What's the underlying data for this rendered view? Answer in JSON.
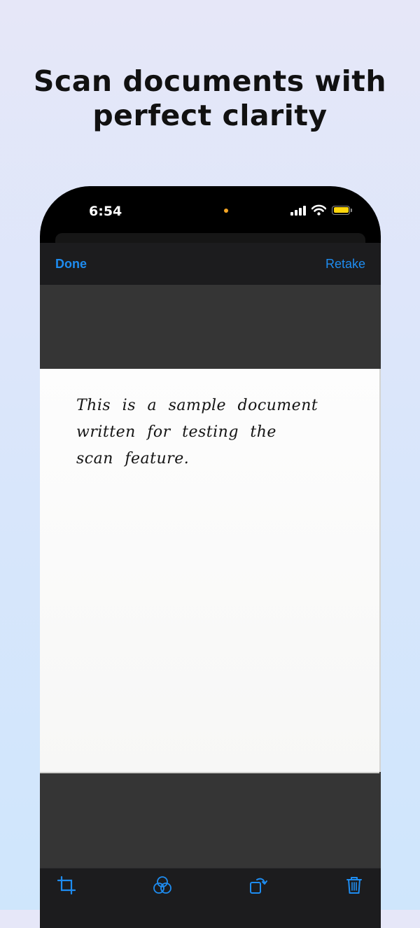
{
  "headline": {
    "line1": "Scan documents with",
    "line2": "perfect clarity"
  },
  "status_bar": {
    "time": "6:54"
  },
  "navbar": {
    "done_label": "Done",
    "retake_label": "Retake"
  },
  "document": {
    "lines": [
      "This is a sample document",
      "written for testing the",
      "scan feature."
    ]
  },
  "toolbar": {
    "icons": [
      "crop-icon",
      "filters-icon",
      "rotate-icon",
      "trash-icon"
    ]
  },
  "colors": {
    "accent": "#1e8cf0",
    "battery": "#ffd60a",
    "camera_indicator": "#f5a524"
  }
}
